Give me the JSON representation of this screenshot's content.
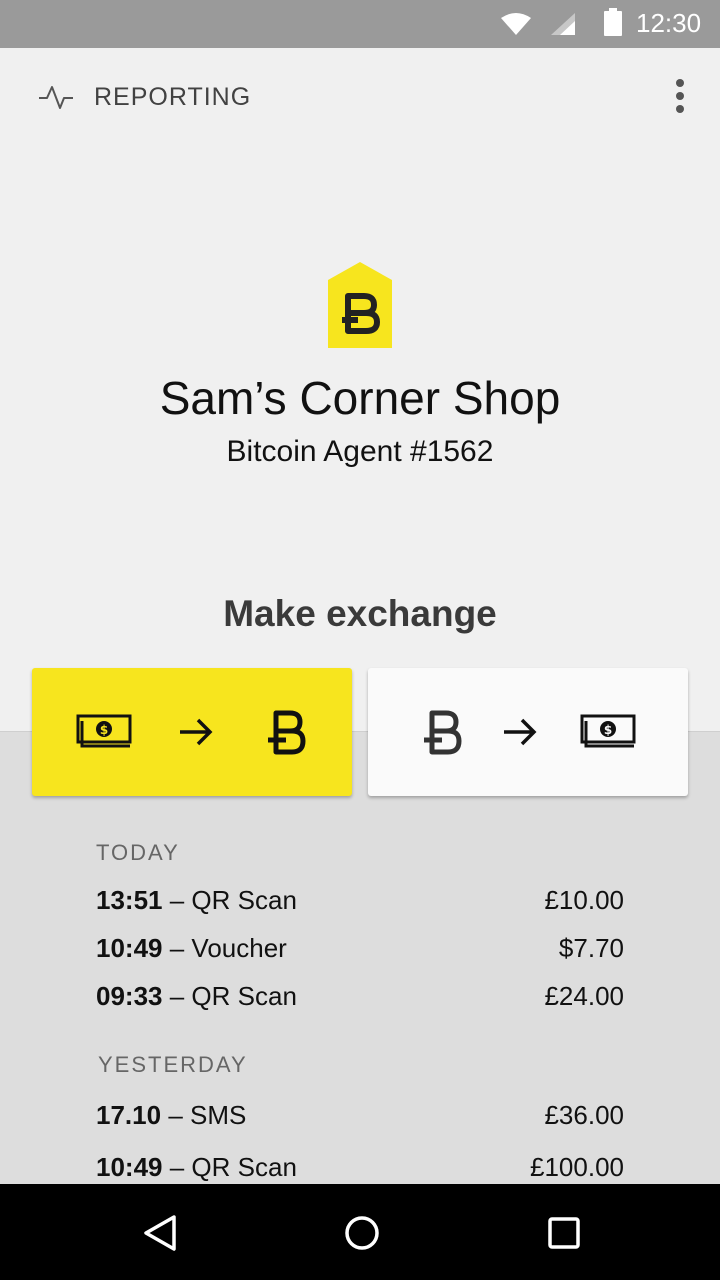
{
  "status_bar": {
    "time": "12:30"
  },
  "app_bar": {
    "title": "REPORTING"
  },
  "agent": {
    "shop_name": "Sam’s Corner Shop",
    "agent_id": "Bitcoin Agent #1562"
  },
  "exchange": {
    "title": "Make exchange"
  },
  "history": [
    {
      "label": "TODAY",
      "items": [
        {
          "time": "13:51",
          "method": "QR Scan",
          "amount": "£10.00"
        },
        {
          "time": "10:49",
          "method": "Voucher",
          "amount": "$7.70"
        },
        {
          "time": "09:33",
          "method": "QR Scan",
          "amount": "£24.00"
        }
      ]
    },
    {
      "label": "YESTERDAY",
      "items": [
        {
          "time": "17.10",
          "method": "SMS",
          "amount": "£36.00"
        },
        {
          "time": "10:49",
          "method": "QR Scan",
          "amount": "£100.00"
        }
      ]
    }
  ],
  "colors": {
    "accent": "#f7e51e",
    "status_bar": "#9a9a9a",
    "background": "#f0f0f0",
    "list_background": "#dddddd"
  }
}
